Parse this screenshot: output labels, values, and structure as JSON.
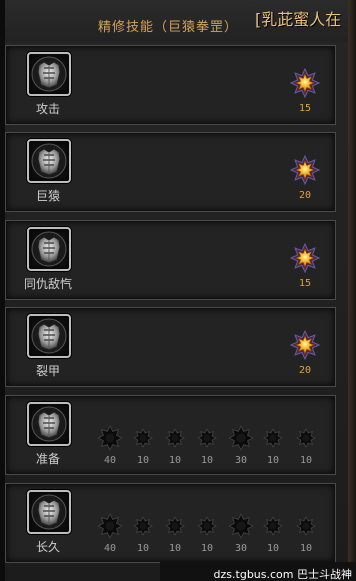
{
  "title": "精修技能（巨猿拳罡）",
  "overlap_text": "[乳茈蜜人在",
  "watermark": "dzs.tgbus.com 巴士斗战神",
  "colors": {
    "title": "#d4a35a",
    "gold_star": "#f0b020",
    "value_gold": "#e0a040",
    "value_gray": "#9a9a9a"
  },
  "skills": [
    {
      "name": "攻击",
      "icon": "armor-icon",
      "stars": [
        {
          "value": "15",
          "active": true
        }
      ]
    },
    {
      "name": "巨猿",
      "icon": "armor-icon",
      "stars": [
        {
          "value": "20",
          "active": true
        }
      ]
    },
    {
      "name": "同仇敌忾",
      "icon": "armor-icon",
      "stars": [
        {
          "value": "15",
          "active": true
        }
      ]
    },
    {
      "name": "裂甲",
      "icon": "armor-icon",
      "stars": [
        {
          "value": "20",
          "active": true
        }
      ]
    },
    {
      "name": "准备",
      "icon": "armor-icon",
      "stars": [
        {
          "value": "40",
          "active": false
        },
        {
          "value": "10",
          "active": false
        },
        {
          "value": "10",
          "active": false
        },
        {
          "value": "10",
          "active": false
        },
        {
          "value": "30",
          "active": false
        },
        {
          "value": "10",
          "active": false
        },
        {
          "value": "10",
          "active": false
        }
      ]
    },
    {
      "name": "长久",
      "icon": "armor-icon",
      "stars": [
        {
          "value": "40",
          "active": false
        },
        {
          "value": "10",
          "active": false
        },
        {
          "value": "10",
          "active": false
        },
        {
          "value": "10",
          "active": false
        },
        {
          "value": "30",
          "active": false
        },
        {
          "value": "10",
          "active": false
        },
        {
          "value": "10",
          "active": false
        }
      ]
    }
  ]
}
